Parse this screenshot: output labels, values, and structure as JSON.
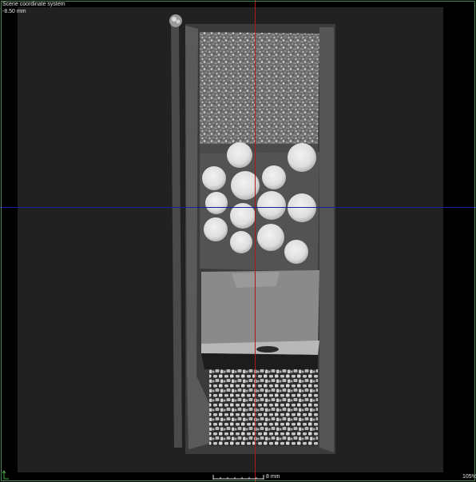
{
  "overlay": {
    "coordinate_system": "Scene coordinate system",
    "slice_position": "-8.50 mm",
    "scale_bar_label": "8 mm",
    "zoom_level": "105%"
  },
  "colors": {
    "background": "#000000",
    "scan_field": "#212121",
    "horizontal_crosshair": "#1a1aa8",
    "vertical_crosshair": "#b01818",
    "frame_border": "#4a8a4a"
  },
  "icons": {
    "axis_indicator": "axis-arrow-icon"
  }
}
